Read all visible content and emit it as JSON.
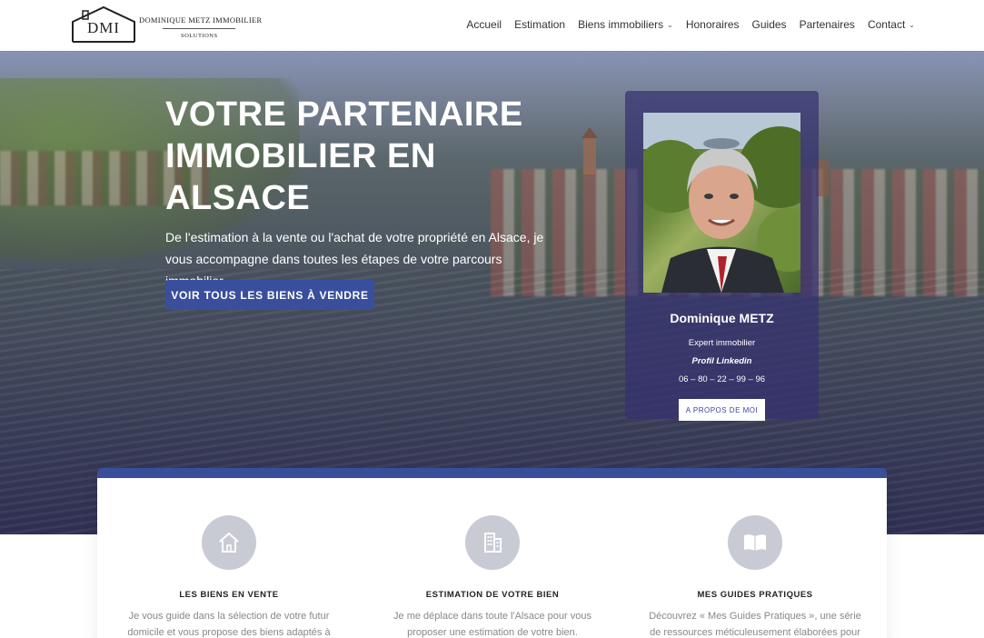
{
  "header": {
    "logo": {
      "monogram": "DMI",
      "name": "DOMINIQUE METZ IMMOBILIER",
      "tagline": "SOLUTIONS"
    },
    "nav": [
      {
        "label": "Accueil",
        "has_dropdown": false
      },
      {
        "label": "Estimation",
        "has_dropdown": false
      },
      {
        "label": "Biens immobiliers",
        "has_dropdown": true
      },
      {
        "label": "Honoraires",
        "has_dropdown": false
      },
      {
        "label": "Guides",
        "has_dropdown": false
      },
      {
        "label": "Partenaires",
        "has_dropdown": false
      },
      {
        "label": "Contact",
        "has_dropdown": true
      }
    ]
  },
  "hero": {
    "title": "VOTRE PARTENAIRE IMMOBILIER EN ALSACE",
    "subtitle": "De l'estimation à la vente ou l'achat de votre propriété en Alsace, je vous accompagne dans toutes les étapes de votre parcours immobilier.",
    "cta": "VOIR TOUS LES BIENS À VENDRE"
  },
  "profile": {
    "name": "Dominique METZ",
    "role": "Expert immobilier",
    "link": "Profil Linkedin",
    "phone": "06 – 80 – 22 – 99 – 96",
    "button": "A PROPOS DE MOI"
  },
  "services": [
    {
      "icon": "house-icon",
      "title": "LES BIENS EN VENTE",
      "text": "Je vous guide dans la sélection de votre futur domicile et vous propose des biens adaptés à vos"
    },
    {
      "icon": "building-icon",
      "title": "ESTIMATION DE VOTRE BIEN",
      "text": "Je me déplace dans toute l'Alsace pour vous proposer une estimation de votre bien."
    },
    {
      "icon": "book-icon",
      "title": "MES GUIDES PRATIQUES",
      "text": "Découvrez « Mes Guides Pratiques », une série de ressources méticuleusement élaborées pour"
    }
  ],
  "colors": {
    "accent": "#3a4f9c",
    "card_overlay": "#343070",
    "icon_circle": "#c9cbd4"
  }
}
